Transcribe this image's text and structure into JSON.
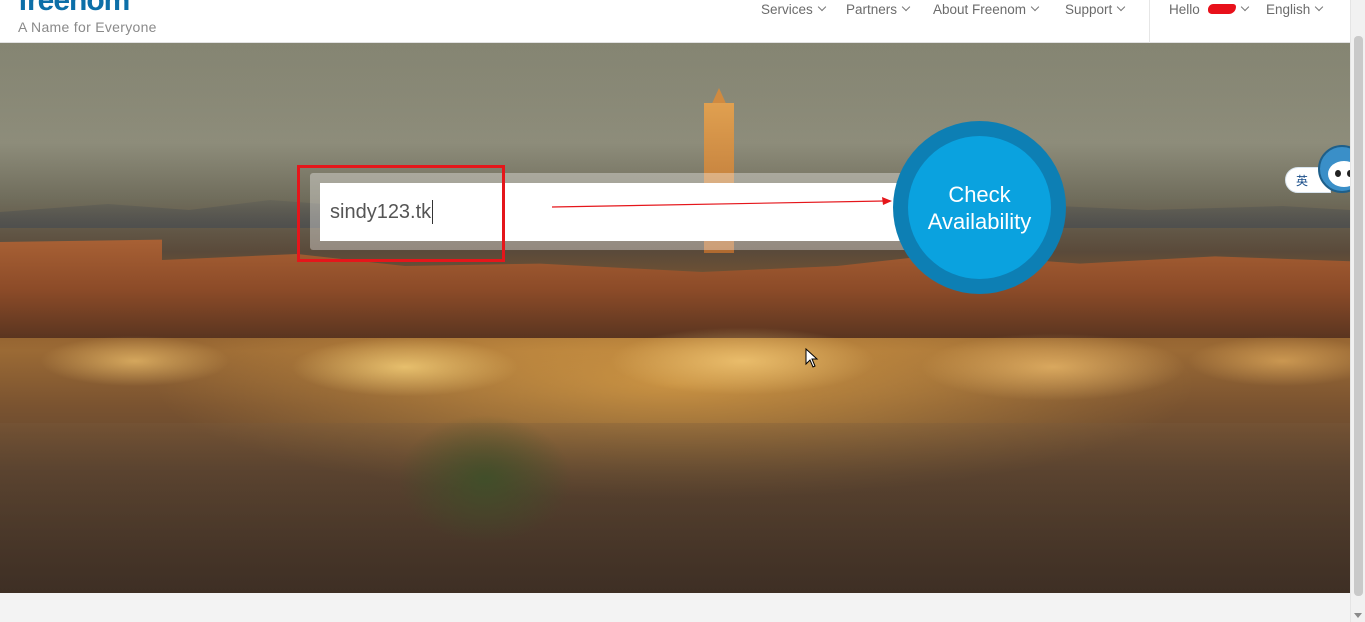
{
  "header": {
    "logo_text": "freenom",
    "tagline": "A Name for Everyone",
    "nav": [
      {
        "label": "Services"
      },
      {
        "label": "Partners"
      },
      {
        "label": "About Freenom"
      },
      {
        "label": "Support"
      }
    ],
    "user_greeting": "Hello",
    "language": "English"
  },
  "search": {
    "value": "sindy123.tk",
    "button_label_line1": "Check",
    "button_label_line2": "Availability"
  },
  "widget": {
    "ime_label": "英"
  },
  "colors": {
    "brand_blue": "#0aa2df",
    "brand_blue_dark": "#0d7fb4",
    "annotation_red": "#e5161b"
  }
}
